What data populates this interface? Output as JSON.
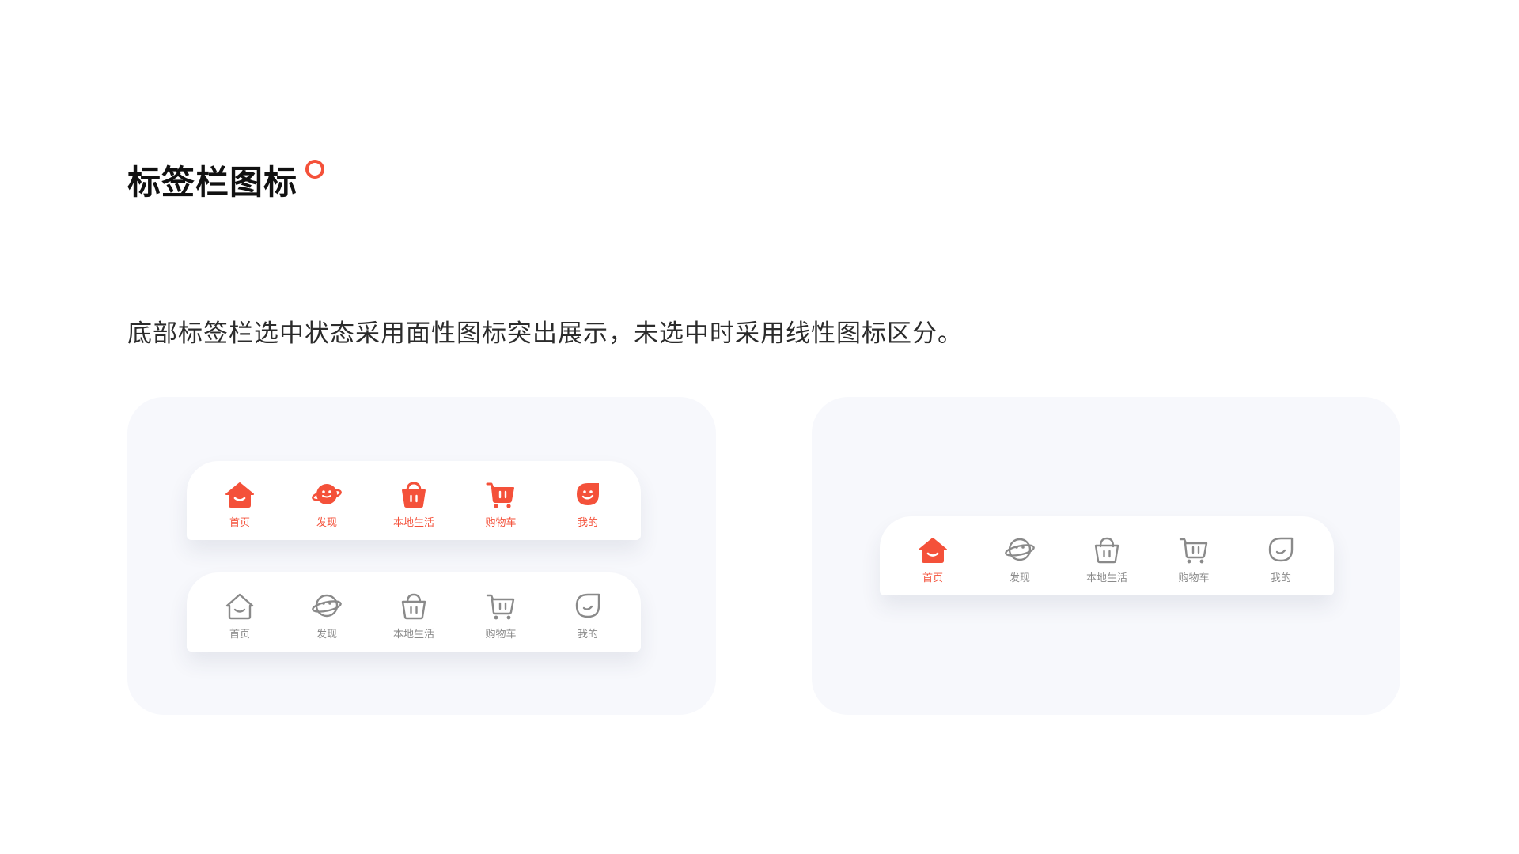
{
  "page": {
    "title": "标签栏图标",
    "description": "底部标签栏选中状态采用面性图标突出展示，未选中时采用线性图标区分。"
  },
  "colors": {
    "accent": "#f4513a",
    "inactive": "#8a8a8a",
    "panel_background": "#f7f8fc"
  },
  "left_panel": {
    "filled_bar": {
      "items": [
        {
          "label": "首页",
          "icon": "home-icon",
          "state": "active"
        },
        {
          "label": "发现",
          "icon": "planet-icon",
          "state": "active"
        },
        {
          "label": "本地生活",
          "icon": "basket-icon",
          "state": "active"
        },
        {
          "label": "购物车",
          "icon": "cart-icon",
          "state": "active"
        },
        {
          "label": "我的",
          "icon": "face-icon",
          "state": "active"
        }
      ]
    },
    "outline_bar": {
      "items": [
        {
          "label": "首页",
          "icon": "home-icon",
          "state": "inactive"
        },
        {
          "label": "发现",
          "icon": "planet-icon",
          "state": "inactive"
        },
        {
          "label": "本地生活",
          "icon": "basket-icon",
          "state": "inactive"
        },
        {
          "label": "购物车",
          "icon": "cart-icon",
          "state": "inactive"
        },
        {
          "label": "我的",
          "icon": "face-icon",
          "state": "inactive"
        }
      ]
    }
  },
  "right_panel": {
    "demo_bar": {
      "selected": "首页",
      "items": [
        {
          "label": "首页",
          "icon": "home-icon",
          "state": "active"
        },
        {
          "label": "发现",
          "icon": "planet-icon",
          "state": "inactive"
        },
        {
          "label": "本地生活",
          "icon": "basket-icon",
          "state": "inactive"
        },
        {
          "label": "购物车",
          "icon": "cart-icon",
          "state": "inactive"
        },
        {
          "label": "我的",
          "icon": "face-icon",
          "state": "inactive"
        }
      ]
    }
  }
}
